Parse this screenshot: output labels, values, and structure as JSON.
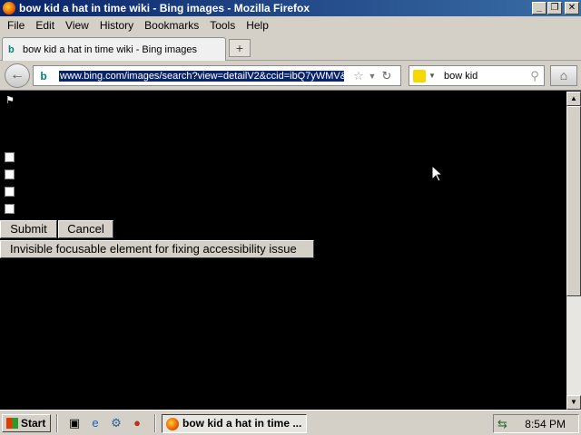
{
  "window": {
    "title": "bow kid a hat in time wiki - Bing images - Mozilla Firefox",
    "minimize_glyph": "_",
    "maximize_glyph": "❐",
    "close_glyph": "✕"
  },
  "menu": {
    "items": [
      "File",
      "Edit",
      "View",
      "History",
      "Bookmarks",
      "Tools",
      "Help"
    ]
  },
  "tabs": {
    "active_title": "bow kid a hat in time wiki - Bing images",
    "newtab_glyph": "+"
  },
  "nav": {
    "url": "www.bing.com/images/search?view=detailV2&ccid=ibQ7yWMV&i",
    "search_query": "bow kid"
  },
  "content": {
    "submit_label": "Submit",
    "cancel_label": "Cancel",
    "accessibility_label": "Invisible focusable element for fixing accessibility issue",
    "checkbox_count": 4
  },
  "taskbar": {
    "start_label": "Start",
    "task_title": "bow kid a hat in time ...",
    "clock": "8:54 PM"
  }
}
